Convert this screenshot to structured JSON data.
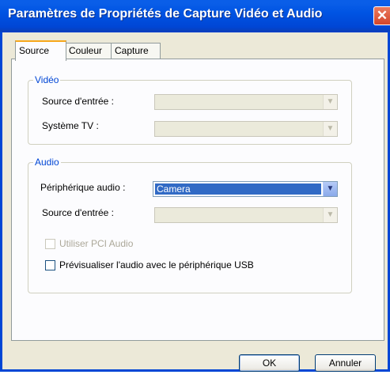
{
  "window": {
    "title": "Paramètres de Propriétés de Capture Vidéo et Audio"
  },
  "tabs": [
    {
      "label": "Source",
      "active": true
    },
    {
      "label": "Couleur",
      "active": false
    },
    {
      "label": "Capture",
      "active": false
    }
  ],
  "video": {
    "group_label": "Vidéo",
    "input_source_label": "Source d'entrée :",
    "tv_system_label": "Système TV :"
  },
  "audio": {
    "group_label": "Audio",
    "device_label": "Périphérique audio :",
    "device_value": "Camera",
    "input_source_label": "Source d'entrée :",
    "pci_audio_label": "Utiliser PCI Audio",
    "preview_label": "Prévisualiser l'audio avec le périphérique USB"
  },
  "buttons": {
    "ok": "OK",
    "cancel": "Annuler"
  },
  "icons": {
    "close": "✕",
    "dropdown": "▼"
  },
  "colors": {
    "titlebar": "#0054e3",
    "selection": "#316ac5",
    "group_label": "#0046d5",
    "tab_highlight": "#f7a81c"
  }
}
